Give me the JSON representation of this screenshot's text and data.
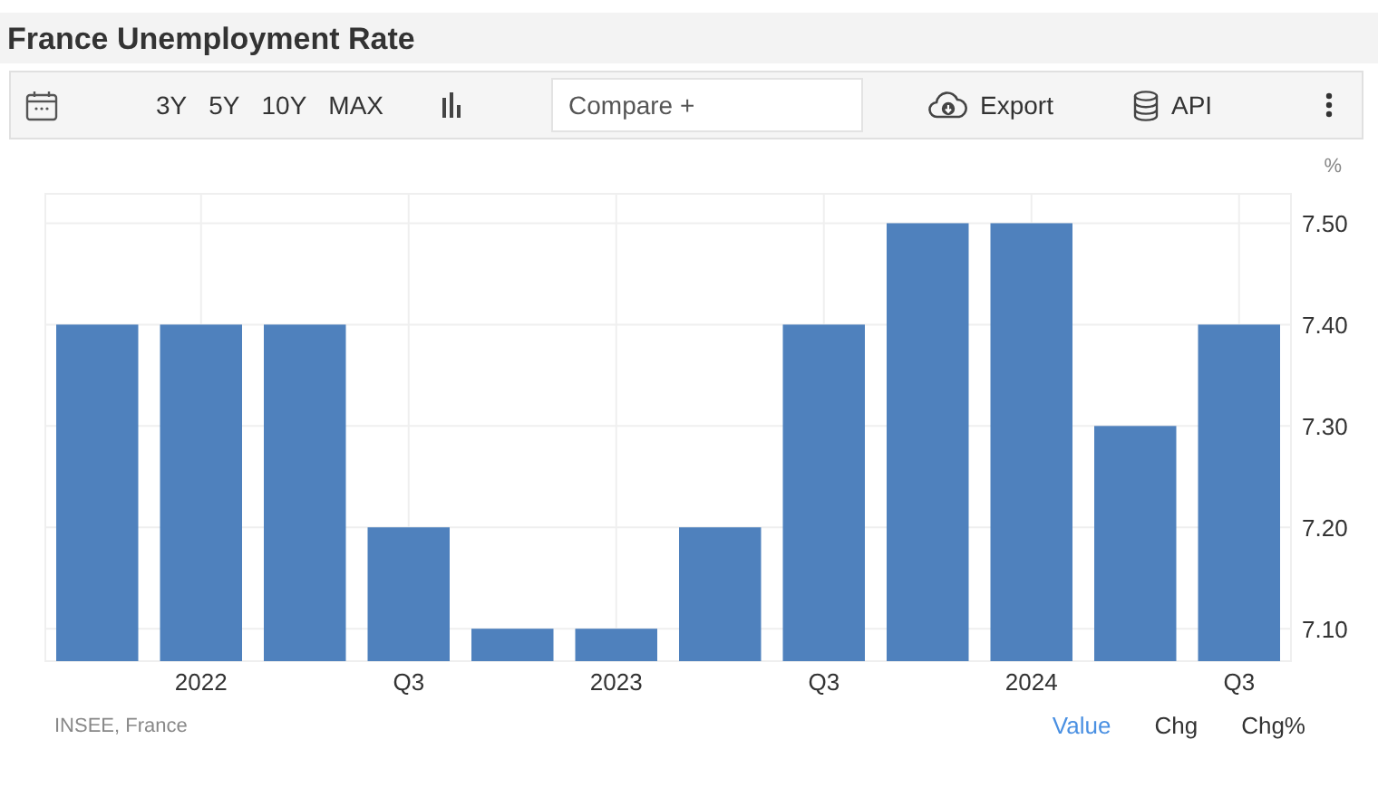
{
  "title": "France Unemployment Rate",
  "toolbar": {
    "ranges": [
      "3Y",
      "5Y",
      "10Y",
      "MAX"
    ],
    "compare": {
      "placeholder": "Compare +"
    },
    "export": "Export",
    "api": "API"
  },
  "chart": {
    "unit": "%",
    "chart_data": {
      "type": "bar",
      "grid": true,
      "categories": [
        null,
        "2022",
        null,
        "Q3",
        null,
        "2023",
        null,
        "Q3",
        null,
        "2024",
        null,
        "Q3"
      ],
      "series": [
        {
          "color": "#4f81bd",
          "values": [
            7.4,
            7.4,
            7.4,
            7.2,
            7.1,
            7.1,
            7.2,
            7.4,
            7.5,
            7.5,
            7.3,
            7.4
          ]
        }
      ],
      "ylim": [
        7.068,
        7.529
      ],
      "yticks": [
        {
          "value": 7.1,
          "label": "7.10"
        },
        {
          "value": 7.2,
          "label": "7.20"
        },
        {
          "value": 7.3,
          "label": "7.30"
        },
        {
          "value": 7.4,
          "label": "7.40"
        },
        {
          "value": 7.5,
          "label": "7.50"
        }
      ]
    }
  },
  "source": "INSEE, France",
  "views": [
    {
      "label": "Value",
      "selected": true
    },
    {
      "label": "Chg",
      "selected": false
    },
    {
      "label": "Chg%",
      "selected": false
    }
  ]
}
